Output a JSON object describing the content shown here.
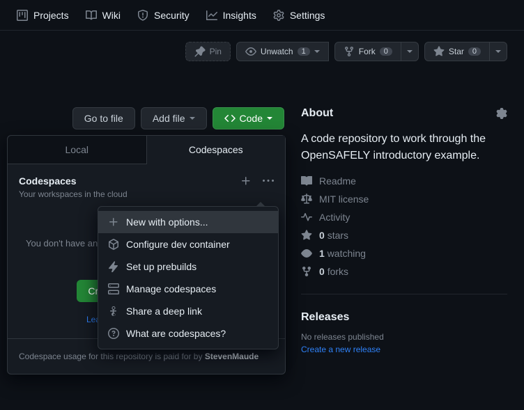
{
  "nav": {
    "projects": "Projects",
    "wiki": "Wiki",
    "security": "Security",
    "insights": "Insights",
    "settings": "Settings"
  },
  "actions": {
    "pin": "Pin",
    "unwatch": "Unwatch",
    "unwatch_count": "1",
    "fork": "Fork",
    "fork_count": "0",
    "star": "Star",
    "star_count": "0"
  },
  "fileButtons": {
    "goToFile": "Go to file",
    "addFile": "Add file",
    "code": "Code"
  },
  "codePanel": {
    "tabLocal": "Local",
    "tabCodespaces": "Codespaces",
    "title": "Codespaces",
    "subtitle": "Your workspaces in the cloud",
    "emptyText": "You don't have any codespaces with this repository checked out",
    "createBtn": "Create codespace on main",
    "learn": "Learn more about codespaces...",
    "footerPrefix": "Codespace usage for this repository is paid for by ",
    "footerUser": "StevenMaude"
  },
  "kebab": {
    "newWithOptions": "New with options...",
    "configure": "Configure dev container",
    "prebuilds": "Set up prebuilds",
    "manage": "Manage codespaces",
    "share": "Share a deep link",
    "whatAre": "What are codespaces?"
  },
  "about": {
    "title": "About",
    "description": "A code repository to work through the OpenSAFELY introductory example.",
    "readme": "Readme",
    "license": "MIT license",
    "activity": "Activity",
    "stars_n": "0",
    "stars_t": "stars",
    "watching_n": "1",
    "watching_t": "watching",
    "forks_n": "0",
    "forks_t": "forks"
  },
  "releases": {
    "title": "Releases",
    "none": "No releases published",
    "create": "Create a new release"
  }
}
